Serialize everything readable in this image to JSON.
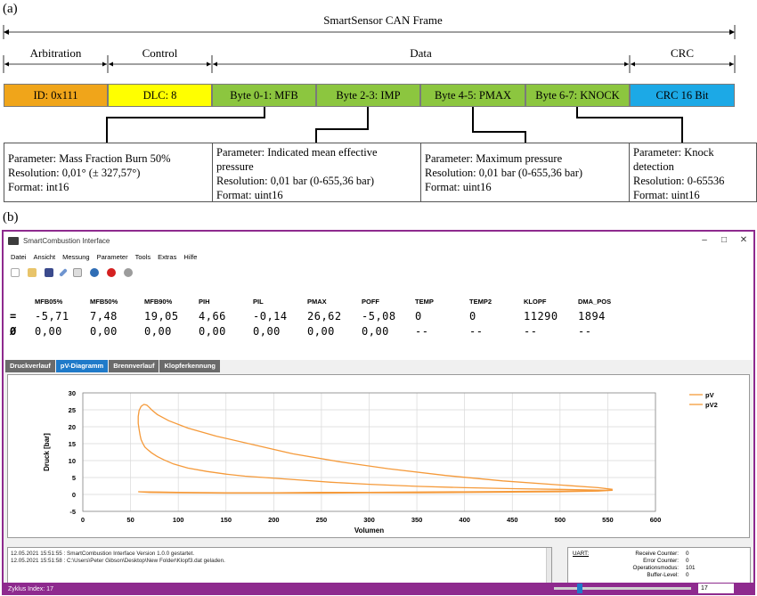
{
  "figure_a": {
    "tag": "(a)",
    "frame_title": "SmartSensor CAN Frame",
    "sections": {
      "arbitration": "Arbitration",
      "control": "Control",
      "data": "Data",
      "crc": "CRC"
    },
    "segments": [
      {
        "label": "ID: 0x111",
        "color": "#f0a51a"
      },
      {
        "label": "DLC: 8",
        "color": "#ffff00"
      },
      {
        "label": "Byte 0-1: MFB",
        "color": "#8cc63f"
      },
      {
        "label": "Byte 2-3: IMP",
        "color": "#8cc63f"
      },
      {
        "label": "Byte 4-5: PMAX",
        "color": "#8cc63f"
      },
      {
        "label": "Byte 6-7: KNOCK",
        "color": "#8cc63f"
      },
      {
        "label": "CRC 16 Bit",
        "color": "#1ca9e6"
      }
    ],
    "params": [
      {
        "l1": "Parameter: Mass Fraction Burn 50%",
        "l2": "Resolution: 0,01° (± 327,57°)",
        "l3": "Format: int16",
        "l4": ""
      },
      {
        "l1": "Parameter: Indicated mean effective",
        "l2": "pressure",
        "l3": "Resolution: 0,01 bar (0-655,36 bar)",
        "l4": "Format: uint16"
      },
      {
        "l1": "Parameter: Maximum pressure",
        "l2": "Resolution: 0,01 bar (0-655,36 bar)",
        "l3": "Format: uint16",
        "l4": ""
      },
      {
        "l1": "Parameter: Knock",
        "l2": "detection",
        "l3": "Resolution: 0-65536",
        "l4": "Format: uint16"
      }
    ]
  },
  "figure_b": {
    "tag": "(b)",
    "window_title": "SmartCombustion Interface",
    "menu": [
      "Datei",
      "Ansicht",
      "Messung",
      "Parameter",
      "Tools",
      "Extras",
      "Hilfe"
    ],
    "toolbar_icons": [
      "new-file-icon",
      "open-folder-icon",
      "save-icon",
      "pen-icon",
      "screen-icon",
      "info-icon",
      "record-icon",
      "stop-icon"
    ],
    "columns": [
      "MFB05%",
      "MFB50%",
      "MFB90%",
      "PIH",
      "PIL",
      "PMAX",
      "POFF",
      "TEMP",
      "TEMP2",
      "KLOPF",
      "DMA_POS"
    ],
    "row_current_mark": "=",
    "row_avg_mark": "Ø",
    "row_current": [
      "-5,71",
      "7,48",
      "19,05",
      "4,66",
      "-0,14",
      "26,62",
      "-5,08",
      "0",
      "0",
      "11290",
      "1894"
    ],
    "row_avg": [
      "0,00",
      "0,00",
      "0,00",
      "0,00",
      "0,00",
      "0,00",
      "0,00",
      "--",
      "--",
      "--",
      "--"
    ],
    "tabs": [
      {
        "label": "Druckverlauf",
        "active": false
      },
      {
        "label": "pV-Diagramm",
        "active": true
      },
      {
        "label": "Brennverlauf",
        "active": false
      },
      {
        "label": "Klopferkennung",
        "active": false
      }
    ],
    "log_lines": [
      "12.05.2021 15:51:55 : SmartCombustion Interface Version 1.0.0 gestartet.",
      "12.05.2021 15:51:58 : C:\\Users\\Peter Gibson\\Desktop\\New Folder\\Klopf3.dat geladen."
    ],
    "uart": {
      "title": "UART:",
      "rows": [
        {
          "label": "Receive Counter:",
          "value": "0"
        },
        {
          "label": "Error Counter:",
          "value": "0"
        },
        {
          "label": "Operationsmodus:",
          "value": "101"
        },
        {
          "label": "Buffer-Level:",
          "value": "0"
        }
      ]
    },
    "status": {
      "label": "Zyklus Index: 17",
      "spin_value": "17",
      "slider_fraction": 0.17
    }
  },
  "chart_data": {
    "type": "line",
    "xlabel": "Volumen",
    "ylabel": "Druck [bar]",
    "xlim": [
      0,
      600
    ],
    "ylim": [
      -5,
      30
    ],
    "xticks": [
      0,
      50,
      100,
      150,
      200,
      250,
      300,
      350,
      400,
      450,
      500,
      550,
      600
    ],
    "yticks": [
      -5,
      0,
      5,
      10,
      15,
      20,
      25,
      30
    ],
    "grid": true,
    "legend": "top-right",
    "series": [
      {
        "name": "pV",
        "color": "#f59a3a",
        "x": [
          555,
          540,
          500,
          450,
          400,
          350,
          300,
          260,
          230,
          210,
          190,
          170,
          150,
          130,
          110,
          95,
          85,
          78,
          72,
          68,
          65,
          63,
          61,
          60,
          59,
          58,
          58,
          59,
          61,
          64,
          67,
          70,
          72,
          78,
          90,
          110,
          140,
          180,
          220,
          270,
          320,
          380,
          440,
          500,
          540,
          555
        ],
        "y": [
          1.2,
          1.3,
          1.5,
          1.7,
          2.0,
          2.4,
          3.0,
          3.6,
          4.2,
          4.6,
          5.0,
          5.4,
          6.0,
          6.8,
          7.8,
          9.0,
          10.2,
          11.2,
          12.3,
          13.2,
          14.0,
          15.0,
          16.2,
          17.5,
          19.2,
          21.0,
          23.0,
          24.8,
          26.0,
          26.6,
          26.4,
          25.6,
          25.0,
          23.6,
          21.8,
          19.6,
          17.2,
          14.6,
          12.0,
          9.6,
          7.6,
          5.6,
          4.0,
          2.8,
          2.0,
          1.5
        ]
      },
      {
        "name": "pV2",
        "color": "#f59a3a",
        "x": [
          58,
          80,
          100,
          150,
          200,
          250,
          300,
          350,
          400,
          450,
          500,
          540,
          555,
          540,
          500,
          450,
          400,
          350,
          300,
          250,
          200,
          150,
          100,
          70,
          58
        ],
        "y": [
          0.8,
          0.7,
          0.6,
          0.5,
          0.5,
          0.6,
          0.6,
          0.7,
          0.8,
          0.9,
          1.0,
          1.1,
          1.2,
          1.0,
          0.8,
          0.7,
          0.6,
          0.5,
          0.5,
          0.4,
          0.4,
          0.4,
          0.5,
          0.6,
          0.8
        ]
      }
    ]
  }
}
